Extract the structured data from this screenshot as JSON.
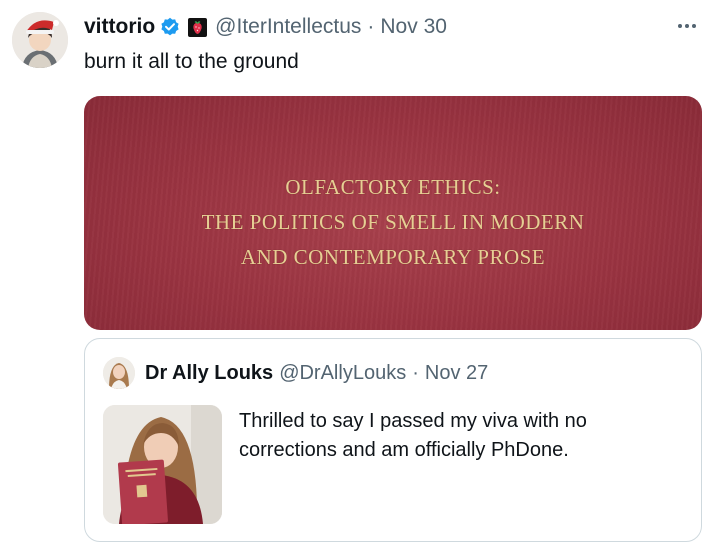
{
  "tweet": {
    "author_name": "vittorio",
    "author_handle": "@IterIntellectus",
    "separator": "·",
    "date": "Nov 30",
    "text": "burn it all to the ground",
    "media": {
      "title_lines": [
        "OLFACTORY ETHICS:",
        "THE POLITICS OF SMELL IN MODERN",
        "AND CONTEMPORARY PROSE"
      ]
    }
  },
  "quoted_tweet": {
    "author_name": "Dr Ally Louks",
    "author_handle": "@DrAllyLouks",
    "separator": "·",
    "date": "Nov 27",
    "text": "Thrilled to say I passed my viva with no corrections and am officially PhDone."
  },
  "colors": {
    "verified_badge": "#1d9bf0",
    "secondary_text": "#536471",
    "cover_red": "#9a3341",
    "cover_gold": "#e6cf94"
  },
  "icons": {
    "verified": "verified-badge-icon",
    "flag": "strawberry-flag-icon",
    "more": "more-options-icon"
  }
}
